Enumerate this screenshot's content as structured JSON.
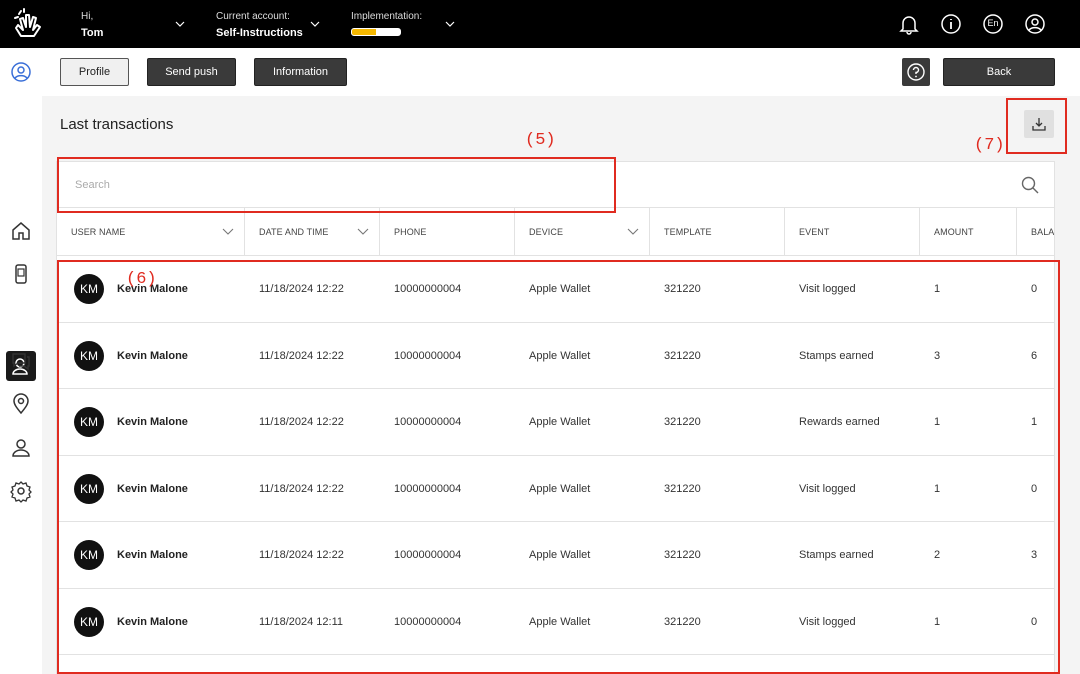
{
  "topbar": {
    "greeting": "Hi,",
    "user_name": "Tom",
    "account_label": "Current account:",
    "account_value": "Self-Instructions",
    "implementation_label": "Implementation:",
    "implementation_progress": 0.5,
    "language": "En"
  },
  "buttons": {
    "profile": "Profile",
    "send_push": "Send push",
    "information": "Information",
    "back": "Back"
  },
  "content": {
    "title": "Last transactions",
    "search_placeholder": "Search"
  },
  "table": {
    "headers": [
      "USER NAME",
      "DATE AND TIME",
      "PHONE",
      "DEVICE",
      "TEMPLATE",
      "EVENT",
      "AMOUNT",
      "BALA"
    ],
    "rows": [
      {
        "initials": "KM",
        "name": "Kevin Malone",
        "datetime": "11/18/2024 12:22",
        "phone": "10000000004",
        "device": "Apple Wallet",
        "template": "321220",
        "event": "Visit logged",
        "amount": "1",
        "balance": "0"
      },
      {
        "initials": "KM",
        "name": "Kevin Malone",
        "datetime": "11/18/2024 12:22",
        "phone": "10000000004",
        "device": "Apple Wallet",
        "template": "321220",
        "event": "Stamps earned",
        "amount": "3",
        "balance": "6"
      },
      {
        "initials": "KM",
        "name": "Kevin Malone",
        "datetime": "11/18/2024 12:22",
        "phone": "10000000004",
        "device": "Apple Wallet",
        "template": "321220",
        "event": "Rewards earned",
        "amount": "1",
        "balance": "1"
      },
      {
        "initials": "KM",
        "name": "Kevin Malone",
        "datetime": "11/18/2024 12:22",
        "phone": "10000000004",
        "device": "Apple Wallet",
        "template": "321220",
        "event": "Visit logged",
        "amount": "1",
        "balance": "0"
      },
      {
        "initials": "KM",
        "name": "Kevin Malone",
        "datetime": "11/18/2024 12:22",
        "phone": "10000000004",
        "device": "Apple Wallet",
        "template": "321220",
        "event": "Stamps earned",
        "amount": "2",
        "balance": "3"
      },
      {
        "initials": "KM",
        "name": "Kevin Malone",
        "datetime": "11/18/2024 12:11",
        "phone": "10000000004",
        "device": "Apple Wallet",
        "template": "321220",
        "event": "Visit logged",
        "amount": "1",
        "balance": "0"
      }
    ]
  },
  "annotations": {
    "search": "(5)",
    "rows": "(6)",
    "download": "(7)"
  },
  "colors": {
    "annotation": "#e02b20",
    "progress_fill": "#f5b800",
    "accent_profile": "#3a6fd8"
  },
  "icons": {
    "top": [
      "bell-icon",
      "info-icon",
      "language-icon",
      "user-circle-icon"
    ],
    "sidebar": [
      "profile-circle-icon",
      "home-icon",
      "mobile-card-icon",
      "users-icon",
      "chat-icon",
      "location-pin-icon",
      "user-admin-icon",
      "settings-gear-icon"
    ]
  }
}
